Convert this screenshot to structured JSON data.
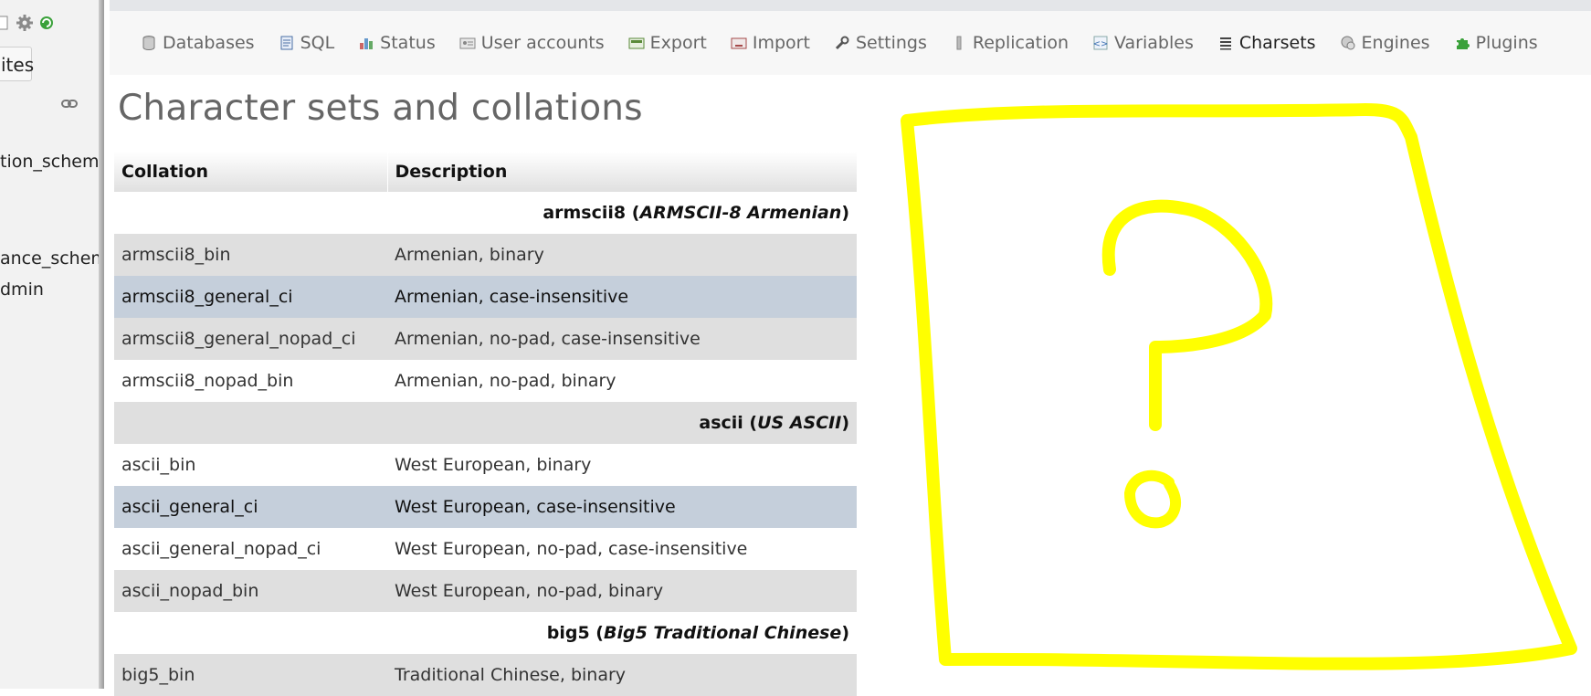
{
  "sidebar": {
    "favorites_label": "ites",
    "databases": [
      {
        "name": "tion_schema"
      },
      {
        "name": "ance_schema"
      },
      {
        "name": "dmin"
      }
    ]
  },
  "menu": [
    {
      "label": "Databases",
      "icon": "database-icon"
    },
    {
      "label": "SQL",
      "icon": "sql-icon"
    },
    {
      "label": "Status",
      "icon": "status-icon"
    },
    {
      "label": "User accounts",
      "icon": "user-accounts-icon"
    },
    {
      "label": "Export",
      "icon": "export-icon"
    },
    {
      "label": "Import",
      "icon": "import-icon"
    },
    {
      "label": "Settings",
      "icon": "wrench-icon"
    },
    {
      "label": "Replication",
      "icon": "replication-icon"
    },
    {
      "label": "Variables",
      "icon": "variables-icon"
    },
    {
      "label": "Charsets",
      "icon": "charsets-icon",
      "active": true
    },
    {
      "label": "Engines",
      "icon": "engines-icon"
    },
    {
      "label": "Plugins",
      "icon": "puzzle-icon"
    }
  ],
  "page": {
    "title": "Character sets and collations"
  },
  "table": {
    "headers": {
      "collation": "Collation",
      "description": "Description"
    },
    "rows": [
      {
        "type": "group",
        "charset": "armscii8",
        "charset_desc": "ARMSCII-8 Armenian"
      },
      {
        "type": "row",
        "collation": "armscii8_bin",
        "description": "Armenian, binary",
        "shade": "odd"
      },
      {
        "type": "row",
        "collation": "armscii8_general_ci",
        "description": "Armenian, case-insensitive",
        "shade": "marked"
      },
      {
        "type": "row",
        "collation": "armscii8_general_nopad_ci",
        "description": "Armenian, no-pad, case-insensitive",
        "shade": "odd"
      },
      {
        "type": "row",
        "collation": "armscii8_nopad_bin",
        "description": "Armenian, no-pad, binary",
        "shade": "even"
      },
      {
        "type": "group",
        "charset": "ascii",
        "charset_desc": "US ASCII",
        "shade": "odd"
      },
      {
        "type": "row",
        "collation": "ascii_bin",
        "description": "West European, binary",
        "shade": "even"
      },
      {
        "type": "row",
        "collation": "ascii_general_ci",
        "description": "West European, case-insensitive",
        "shade": "marked"
      },
      {
        "type": "row",
        "collation": "ascii_general_nopad_ci",
        "description": "West European, no-pad, case-insensitive",
        "shade": "even"
      },
      {
        "type": "row",
        "collation": "ascii_nopad_bin",
        "description": "West European, no-pad, binary",
        "shade": "odd"
      },
      {
        "type": "group",
        "charset": "big5",
        "charset_desc": "Big5 Traditional Chinese"
      },
      {
        "type": "row",
        "collation": "big5_bin",
        "description": "Traditional Chinese, binary",
        "shade": "odd"
      }
    ]
  },
  "overlay": {
    "color": "#ffff00",
    "symbol": "?"
  }
}
